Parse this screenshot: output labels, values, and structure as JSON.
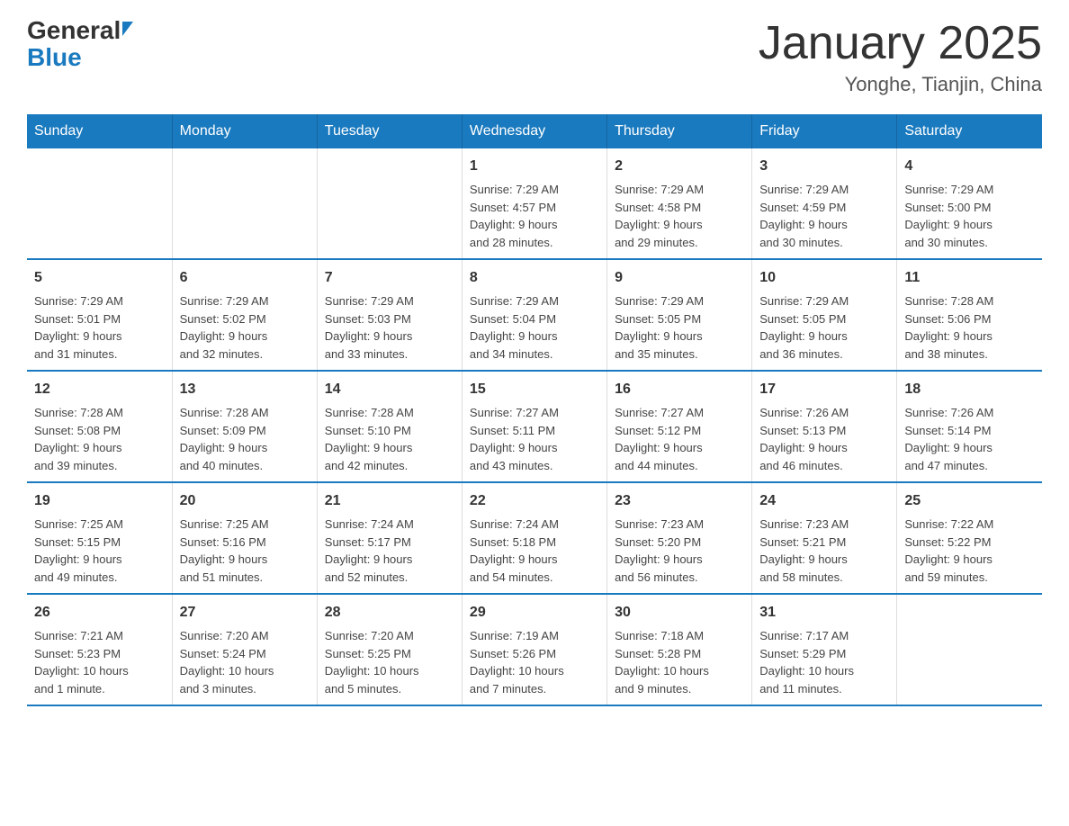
{
  "logo": {
    "general": "General",
    "blue": "Blue"
  },
  "title": "January 2025",
  "location": "Yonghe, Tianjin, China",
  "days": [
    "Sunday",
    "Monday",
    "Tuesday",
    "Wednesday",
    "Thursday",
    "Friday",
    "Saturday"
  ],
  "weeks": [
    [
      {
        "day": "",
        "info": ""
      },
      {
        "day": "",
        "info": ""
      },
      {
        "day": "",
        "info": ""
      },
      {
        "day": "1",
        "info": "Sunrise: 7:29 AM\nSunset: 4:57 PM\nDaylight: 9 hours\nand 28 minutes."
      },
      {
        "day": "2",
        "info": "Sunrise: 7:29 AM\nSunset: 4:58 PM\nDaylight: 9 hours\nand 29 minutes."
      },
      {
        "day": "3",
        "info": "Sunrise: 7:29 AM\nSunset: 4:59 PM\nDaylight: 9 hours\nand 30 minutes."
      },
      {
        "day": "4",
        "info": "Sunrise: 7:29 AM\nSunset: 5:00 PM\nDaylight: 9 hours\nand 30 minutes."
      }
    ],
    [
      {
        "day": "5",
        "info": "Sunrise: 7:29 AM\nSunset: 5:01 PM\nDaylight: 9 hours\nand 31 minutes."
      },
      {
        "day": "6",
        "info": "Sunrise: 7:29 AM\nSunset: 5:02 PM\nDaylight: 9 hours\nand 32 minutes."
      },
      {
        "day": "7",
        "info": "Sunrise: 7:29 AM\nSunset: 5:03 PM\nDaylight: 9 hours\nand 33 minutes."
      },
      {
        "day": "8",
        "info": "Sunrise: 7:29 AM\nSunset: 5:04 PM\nDaylight: 9 hours\nand 34 minutes."
      },
      {
        "day": "9",
        "info": "Sunrise: 7:29 AM\nSunset: 5:05 PM\nDaylight: 9 hours\nand 35 minutes."
      },
      {
        "day": "10",
        "info": "Sunrise: 7:29 AM\nSunset: 5:05 PM\nDaylight: 9 hours\nand 36 minutes."
      },
      {
        "day": "11",
        "info": "Sunrise: 7:28 AM\nSunset: 5:06 PM\nDaylight: 9 hours\nand 38 minutes."
      }
    ],
    [
      {
        "day": "12",
        "info": "Sunrise: 7:28 AM\nSunset: 5:08 PM\nDaylight: 9 hours\nand 39 minutes."
      },
      {
        "day": "13",
        "info": "Sunrise: 7:28 AM\nSunset: 5:09 PM\nDaylight: 9 hours\nand 40 minutes."
      },
      {
        "day": "14",
        "info": "Sunrise: 7:28 AM\nSunset: 5:10 PM\nDaylight: 9 hours\nand 42 minutes."
      },
      {
        "day": "15",
        "info": "Sunrise: 7:27 AM\nSunset: 5:11 PM\nDaylight: 9 hours\nand 43 minutes."
      },
      {
        "day": "16",
        "info": "Sunrise: 7:27 AM\nSunset: 5:12 PM\nDaylight: 9 hours\nand 44 minutes."
      },
      {
        "day": "17",
        "info": "Sunrise: 7:26 AM\nSunset: 5:13 PM\nDaylight: 9 hours\nand 46 minutes."
      },
      {
        "day": "18",
        "info": "Sunrise: 7:26 AM\nSunset: 5:14 PM\nDaylight: 9 hours\nand 47 minutes."
      }
    ],
    [
      {
        "day": "19",
        "info": "Sunrise: 7:25 AM\nSunset: 5:15 PM\nDaylight: 9 hours\nand 49 minutes."
      },
      {
        "day": "20",
        "info": "Sunrise: 7:25 AM\nSunset: 5:16 PM\nDaylight: 9 hours\nand 51 minutes."
      },
      {
        "day": "21",
        "info": "Sunrise: 7:24 AM\nSunset: 5:17 PM\nDaylight: 9 hours\nand 52 minutes."
      },
      {
        "day": "22",
        "info": "Sunrise: 7:24 AM\nSunset: 5:18 PM\nDaylight: 9 hours\nand 54 minutes."
      },
      {
        "day": "23",
        "info": "Sunrise: 7:23 AM\nSunset: 5:20 PM\nDaylight: 9 hours\nand 56 minutes."
      },
      {
        "day": "24",
        "info": "Sunrise: 7:23 AM\nSunset: 5:21 PM\nDaylight: 9 hours\nand 58 minutes."
      },
      {
        "day": "25",
        "info": "Sunrise: 7:22 AM\nSunset: 5:22 PM\nDaylight: 9 hours\nand 59 minutes."
      }
    ],
    [
      {
        "day": "26",
        "info": "Sunrise: 7:21 AM\nSunset: 5:23 PM\nDaylight: 10 hours\nand 1 minute."
      },
      {
        "day": "27",
        "info": "Sunrise: 7:20 AM\nSunset: 5:24 PM\nDaylight: 10 hours\nand 3 minutes."
      },
      {
        "day": "28",
        "info": "Sunrise: 7:20 AM\nSunset: 5:25 PM\nDaylight: 10 hours\nand 5 minutes."
      },
      {
        "day": "29",
        "info": "Sunrise: 7:19 AM\nSunset: 5:26 PM\nDaylight: 10 hours\nand 7 minutes."
      },
      {
        "day": "30",
        "info": "Sunrise: 7:18 AM\nSunset: 5:28 PM\nDaylight: 10 hours\nand 9 minutes."
      },
      {
        "day": "31",
        "info": "Sunrise: 7:17 AM\nSunset: 5:29 PM\nDaylight: 10 hours\nand 11 minutes."
      },
      {
        "day": "",
        "info": ""
      }
    ]
  ]
}
